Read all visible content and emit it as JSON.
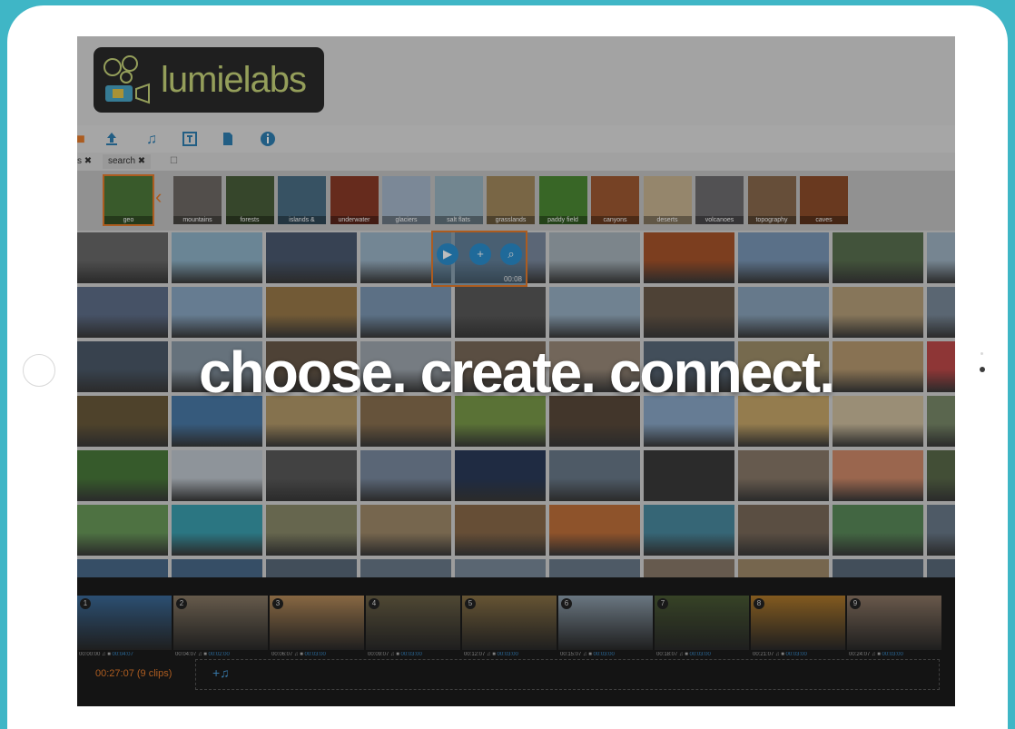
{
  "slogan": "choose. create. connect.",
  "app": {
    "logo_text": "lumielabs"
  },
  "toolbar": {
    "icons": [
      "upload-icon",
      "music-icon",
      "text-icon",
      "document-icon",
      "info-icon"
    ]
  },
  "tabs": [
    {
      "label": "search"
    }
  ],
  "categories": [
    {
      "label": "geo",
      "color": "#4e7a3a"
    },
    {
      "label": "mountains",
      "color": "#6f6a66"
    },
    {
      "label": "forests",
      "color": "#4a5f3a"
    },
    {
      "label": "islands &",
      "color": "#4b6f86"
    },
    {
      "label": "underwater",
      "color": "#8a3a28"
    },
    {
      "label": "glaciers",
      "color": "#a7b8cc"
    },
    {
      "label": "salt flats",
      "color": "#9ab5c3"
    },
    {
      "label": "grasslands",
      "color": "#a48a5e"
    },
    {
      "label": "paddy field",
      "color": "#4c8a34"
    },
    {
      "label": "canyons",
      "color": "#a05a32"
    },
    {
      "label": "deserts",
      "color": "#c9b592"
    },
    {
      "label": "volcanoes",
      "color": "#6f6e70"
    },
    {
      "label": "topography",
      "color": "#8a6a4d"
    },
    {
      "label": "caves",
      "color": "#8e4e2a"
    }
  ],
  "hover": {
    "duration": "00:08"
  },
  "timeline": {
    "total": "00:27:07  (9 clips)",
    "clips": [
      {
        "num": "1",
        "start": "00:00:00",
        "dur": "00:04:07",
        "color": "#3b6b9a"
      },
      {
        "num": "2",
        "start": "00:04:07",
        "dur": "00:02:00",
        "color": "#8a7a66"
      },
      {
        "num": "3",
        "start": "00:06:07",
        "dur": "00:03:00",
        "color": "#b78c5a"
      },
      {
        "num": "4",
        "start": "00:09:07",
        "dur": "00:03:00",
        "color": "#6b6146"
      },
      {
        "num": "5",
        "start": "00:12:07",
        "dur": "00:03:00",
        "color": "#8a7246"
      },
      {
        "num": "6",
        "start": "00:15:07",
        "dur": "00:03:00",
        "color": "#8fa0ae"
      },
      {
        "num": "7",
        "start": "00:18:07",
        "dur": "00:03:00",
        "color": "#4a5a34"
      },
      {
        "num": "8",
        "start": "00:21:07",
        "dur": "00:03:00",
        "color": "#b07a2a"
      },
      {
        "num": "9",
        "start": "00:24:07",
        "dur": "00:03:00",
        "color": "#8e7866"
      }
    ]
  },
  "grid_colors": [
    [
      "#6a6a6a",
      "#8fb4c9",
      "#4b5a70",
      "#9cb5c8",
      "#7b8aa0",
      "#a8b4bc",
      "#a8542a",
      "#7a98b8",
      "#5a7050",
      "#a0b4c4"
    ],
    [
      "#5f6f8a",
      "#8aa8c4",
      "#9a7a4a",
      "#7c98b4",
      "#5a5a5a",
      "#98b0c4",
      "#6a5a4a",
      "#8aa4bc",
      "#b6a07a",
      "#7a8a9a"
    ],
    [
      "#4c5a6a",
      "#8a9aa8",
      "#6a5a4a",
      "#a0a8b0",
      "#7a6a5a",
      "#9a8a7a",
      "#5a6a7a",
      "#a0906a",
      "#b89a70",
      "#c04a4a"
    ],
    [
      "#6a5a3a",
      "#4a7aa8",
      "#b49a6a",
      "#8a7050",
      "#7a9a4a",
      "#5a4a3a",
      "#8aa8c8",
      "#c8a86a",
      "#d0c0a0",
      "#7a8a6a"
    ],
    [
      "#4a7a3a",
      "#c0c8d0",
      "#5a5a5a",
      "#7a8aa0",
      "#2a3a5a",
      "#6a7a8a",
      "#3a3a3a",
      "#8a7a6a",
      "#d08a6a",
      "#5a6a4a"
    ],
    [
      "#6a9a5a",
      "#3aa0b0",
      "#8a8a6a",
      "#a08a6a",
      "#8a6a4a",
      "#c0703a",
      "#4a8aa0",
      "#7a6a5a",
      "#5a8a5a",
      "#6a7a8a"
    ],
    [
      "#4a6a8a",
      "#4a6a8a",
      "#5a6a7a",
      "#6a7a8a",
      "#7a8a9a",
      "#6a7a8a",
      "#8a7a6a",
      "#a08a6a",
      "#5a6a7a",
      "#5a6a7a"
    ]
  ]
}
